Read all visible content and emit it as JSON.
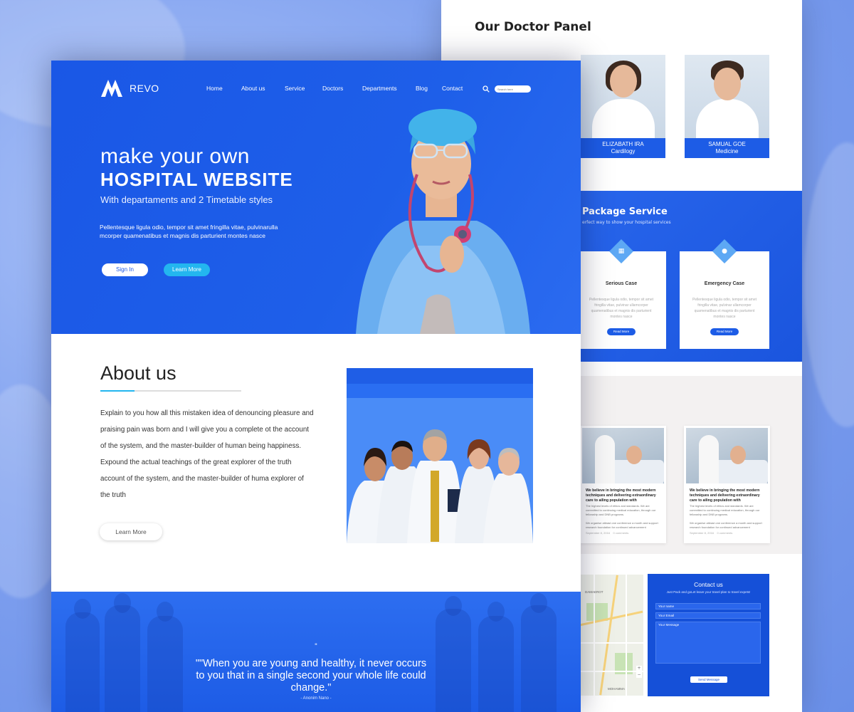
{
  "nav": {
    "logo_text": "REVO",
    "items": [
      "Home",
      "About us",
      "Service",
      "Doctors",
      "Departments",
      "Blog",
      "Contact"
    ],
    "search_placeholder": "Search here"
  },
  "hero": {
    "line1": "make your own",
    "line2": "HOSPITAL WEBSITE",
    "line3": "With departaments and 2 Timetable styles",
    "paragraph": "Pellentesque ligula odio, tempor sit amet fringilla vitae, pulvinarulla mcorper quamenatibus et magnis dis parturient montes nasce",
    "signin_label": "Sign In",
    "learn_label": "Learn More"
  },
  "about": {
    "title": "About us",
    "text": "Explain to you how all this mistaken idea of denouncing pleasure and praising pain was born and I will give you a complete ot the account of the system, and the master-builder of human being happiness. Expound the actual teachings of the great explorer of the truth account of the system, and the master-builder of huma explorer of the truth",
    "button_label": "Learn More"
  },
  "quote": {
    "mark": "\"",
    "text": "\"\"When you are young and healthy, it never occurs to you that in a single second your whole life could change.\"",
    "author": "- Anonim Nano -"
  },
  "doctors": {
    "title": "Our Doctor Panel",
    "cards": [
      {
        "name": "ELIZABATH IRA",
        "dept": "Cardilogy"
      },
      {
        "name": "SAMUAL GOE",
        "dept": "Medicine"
      }
    ]
  },
  "package": {
    "title": "Package Service",
    "subtitle": "erfect way to show your hospital services",
    "cards": [
      {
        "title": "Serious Case",
        "text": "Pellentesque ligula odio, tempor sit amet fringilla vitae, pulvinar ullamcorper quamenatibus et magnis dis parturient montes nasce",
        "button": "Read More",
        "icon": "calendar-icon"
      },
      {
        "title": "Emergency Case",
        "text": "Pellentesque ligula odio, tempor sit amet fringilla vitae, pulvinar ullamcorper quamenatibus et magnis dis parturient montes nasce",
        "button": "Read More",
        "icon": "chat-icon"
      }
    ]
  },
  "blog": {
    "cards": [
      {
        "title": "We believe in bringing the most modern techniques and delivering extraordinary care to ailing population with",
        "p1": "The highest levels of ethics and standards. We are committed to continuing medical education, through our fellowship and DNB programs.",
        "p2": "We organise atleast one conference a month and support research foundation for continued advancement",
        "date": "September 8, 2016",
        "comments": "0 comments"
      },
      {
        "title": "We believe in bringing the most modern techniques and delivering extraordinary care to ailing population with",
        "p1": "The highest levels of ethics and standards. We are committed to continuing medical education, through our fellowship and DNB programs.",
        "p2": "We organise atleast one conference a month and support research foundation for continued advancement",
        "date": "September 8, 2016",
        "comments": "0 comments"
      }
    ]
  },
  "contact": {
    "title": "Contact us",
    "subtitle": "Just Pack and goLet leave your travel plan to travel expets!",
    "name_ph": "Your name",
    "email_ph": "Your Email",
    "message_ph": "Your Message",
    "send_label": "Send Message",
    "map_label_1": "DAMAEROT",
    "map_label_2": "MOHAMMA"
  },
  "colors": {
    "primary": "#1d5ce6",
    "accent": "#23b6ef"
  }
}
